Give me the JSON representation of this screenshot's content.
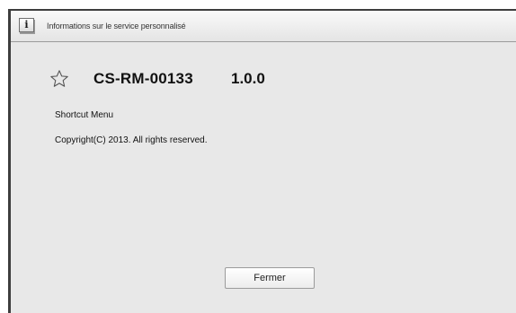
{
  "dialog": {
    "title": "Informations sur le service personnalisé",
    "info_icon_glyph": "i",
    "app_name": "CS-RM-00133",
    "app_version": "1.0.0",
    "description": "Shortcut Menu",
    "copyright": "Copyright(C) 2013. All rights reserved.",
    "close_label": "Fermer"
  },
  "icons": {
    "info": "info-icon",
    "favorite": "star-outline-icon"
  },
  "colors": {
    "background": "#e8e8e8",
    "border": "#3d3d3d",
    "text": "#111111"
  }
}
